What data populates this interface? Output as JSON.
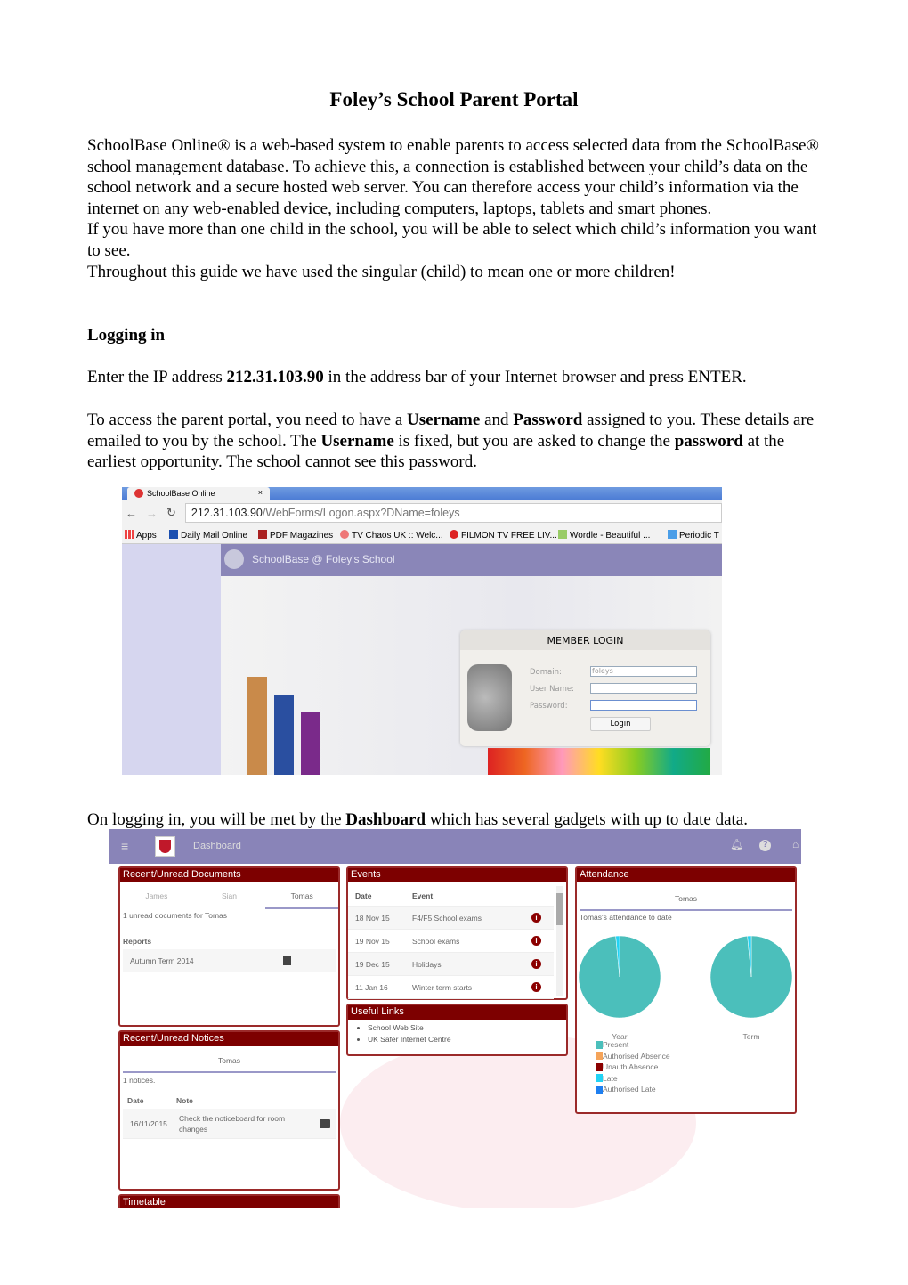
{
  "title": "Foley’s School Parent Portal",
  "intro": {
    "p1": "SchoolBase Online® is a web-based system to enable parents to access selected data from the SchoolBase® school management database.  To achieve this, a connection is established between your child’s data on the school network and a secure hosted web server. You can therefore access your child’s information via the internet on any web-enabled device, including computers, laptops, tablets and smart phones.",
    "p2": "If you have more than one child in the school, you will be able to select which child’s information you want to see.",
    "p3": "Throughout this guide we have used the singular (child) to mean one or more children!"
  },
  "logging": {
    "heading": "Logging in",
    "ip_pre": "Enter the IP address ",
    "ip": "212.31.103.90",
    "ip_post": " in the address bar of your Internet browser and press ENTER.",
    "a1": "To access the parent portal, you need to have a ",
    "u1": "Username",
    "a2": " and ",
    "pw1": "Password",
    "a3": " assigned to you.  These details are emailed to you by the school. The ",
    "u2": "Username",
    "a4": " is fixed, but you are asked to change the ",
    "pw2": "password",
    "a5": " at the earliest opportunity. The school cannot see this password."
  },
  "browser": {
    "tab_title": "SchoolBase Online",
    "tab_close": "×",
    "url_host": "212.31.103.90",
    "url_path": "/WebForms/Logon.aspx?DName=foleys",
    "bookmarks": [
      "Apps",
      "Daily Mail Online",
      "PDF Magazines",
      "TV Chaos UK :: Welc...",
      "FILMON TV FREE LIV...",
      "Wordle - Beautiful ...",
      "Periodic T"
    ],
    "app_title": "SchoolBase @ Foley's School",
    "login": {
      "title": "MEMBER LOGIN",
      "domain_label": "Domain:",
      "domain_value": "foleys",
      "user_label": "User Name:",
      "password_label": "Password:",
      "button": "Login"
    }
  },
  "dashboard_intro": {
    "pre": "On logging in, you will be met by the ",
    "bold": "Dashboard",
    "post": " which has several gadgets with up to date data."
  },
  "dashboard": {
    "title": "Dashboard",
    "documents": {
      "title": "Recent/Unread Documents",
      "tabs": [
        "James",
        "Sian",
        "Tomas"
      ],
      "active_tab": "Tomas",
      "summary": "1 unread documents for Tomas",
      "section": "Reports",
      "items": [
        "Autumn Term 2014"
      ]
    },
    "notices": {
      "title": "Recent/Unread Notices",
      "child": "Tomas",
      "summary": "1 notices.",
      "col_date": "Date",
      "col_note": "Note",
      "rows": [
        {
          "date": "16/11/2015",
          "note": "Check the noticeboard for room changes"
        }
      ]
    },
    "timetable": {
      "title": "Timetable"
    },
    "events": {
      "title": "Events",
      "col_date": "Date",
      "col_event": "Event",
      "rows": [
        {
          "date": "18 Nov 15",
          "event": "F4/F5 School exams"
        },
        {
          "date": "19 Nov 15",
          "event": "School exams"
        },
        {
          "date": "19 Dec 15",
          "event": "Holidays"
        },
        {
          "date": "11 Jan 16",
          "event": "Winter term starts"
        }
      ]
    },
    "links": {
      "title": "Useful Links",
      "items": [
        "School Web Site",
        "UK Safer Internet Centre"
      ]
    },
    "attendance": {
      "title": "Attendance",
      "child": "Tomas",
      "subtitle": "Tomas's attendance to date",
      "chart_data": {
        "type": "pie",
        "charts": [
          {
            "title": "Year",
            "values": [
              98.5,
              0,
              0,
              1.5,
              0
            ]
          },
          {
            "title": "Term",
            "values": [
              98.5,
              0,
              0,
              1.5,
              0
            ]
          }
        ],
        "legend": [
          {
            "name": "Present",
            "color": "#4bbfbb"
          },
          {
            "name": "Authorised Absence",
            "color": "#f5a45a"
          },
          {
            "name": "Unauth Absence",
            "color": "#8b0000"
          },
          {
            "name": "Late",
            "color": "#22d3f5"
          },
          {
            "name": "Authorised Late",
            "color": "#1e7ff0"
          }
        ]
      }
    }
  }
}
